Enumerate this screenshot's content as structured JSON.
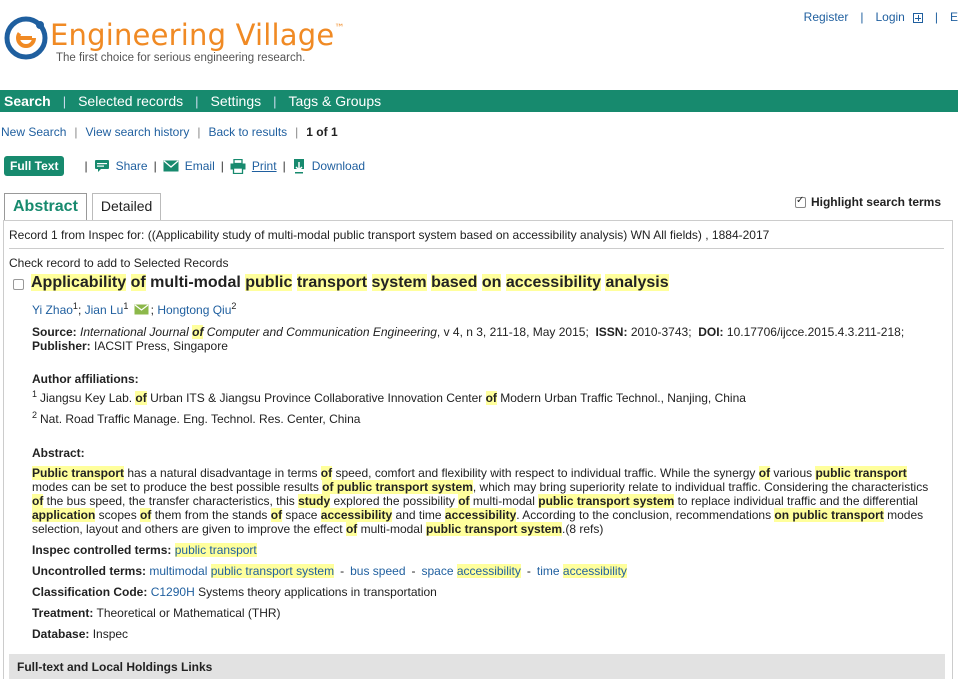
{
  "header": {
    "logo_text": "Engineering Village",
    "logo_tm": "™",
    "tagline": "The first choice for serious engineering research.",
    "register": "Register",
    "login": "Login",
    "extra": "E",
    "brand_orange": "#f08a24",
    "brand_blue": "#1f5f9f"
  },
  "nav": {
    "items": [
      "Search",
      "Selected records",
      "Settings",
      "Tags & Groups"
    ],
    "bg_color": "#178a6e"
  },
  "subnav": {
    "new_search": "New Search",
    "view_history": "View search history",
    "back": "Back to results",
    "count": "1 of 1"
  },
  "toolbar": {
    "full_text": "Full Text",
    "share": "Share",
    "email": "Email",
    "print": "Print",
    "download": "Download"
  },
  "tabs": {
    "abstract": "Abstract",
    "detailed": "Detailed",
    "highlight_label": "Highlight search terms",
    "highlight_checked": true
  },
  "record": {
    "info": "Record 1 from Inspec for: ((Applicability study of multi-modal public transport system based on accessibility analysis) WN All fields) , 1884-2017",
    "check_label": "Check record to add to Selected Records",
    "title_parts": [
      {
        "t": "Applicability",
        "h": true
      },
      {
        "t": " ",
        "h": false
      },
      {
        "t": "of",
        "h": true
      },
      {
        "t": " multi-modal ",
        "h": false
      },
      {
        "t": "public",
        "h": true
      },
      {
        "t": " ",
        "h": false
      },
      {
        "t": "transport",
        "h": true
      },
      {
        "t": " ",
        "h": false
      },
      {
        "t": "system",
        "h": true
      },
      {
        "t": " ",
        "h": false
      },
      {
        "t": "based",
        "h": true
      },
      {
        "t": " ",
        "h": false
      },
      {
        "t": "on",
        "h": true
      },
      {
        "t": " ",
        "h": false
      },
      {
        "t": "accessibility",
        "h": true
      },
      {
        "t": " ",
        "h": false
      },
      {
        "t": "analysis",
        "h": true
      }
    ],
    "authors": [
      {
        "name": "Yi Zhao",
        "sup": "1"
      },
      {
        "name": "Jian Lu",
        "sup": "1"
      },
      {
        "name": "Hongtong Qiu",
        "sup": "2"
      }
    ],
    "source_label": "Source:",
    "source_journal_pre": "International Journal ",
    "source_journal_of": "of",
    "source_journal_post": " Computer and Communication Engineering",
    "source_details": ", v 4, n 3, 211-18, May 2015;",
    "issn_label": "ISSN:",
    "issn": "2010-3743;",
    "doi_label": "DOI:",
    "doi": "10.17706/ijcce.2015.4.3.211-218;",
    "publisher_label": "Publisher:",
    "publisher": "IACSIT Press, Singapore",
    "aff_label": "Author affiliations:",
    "aff1_sup": "1",
    "aff1_pre": "Jiangsu Key Lab. ",
    "aff1_mid": " Urban ITS & Jiangsu Province Collaborative Innovation Center ",
    "aff1_post": " Modern Urban Traffic Technol., Nanjing, China",
    "of": "of",
    "aff2_sup": "2",
    "aff2": "Nat. Road Traffic Manage. Eng. Technol. Res. Center, China",
    "abstract_label": "Abstract:",
    "abstract_parts": [
      {
        "t": "Public transport",
        "h": true
      },
      {
        "t": " has a natural disadvantage in terms ",
        "h": false
      },
      {
        "t": "of",
        "h": true
      },
      {
        "t": " speed, comfort and flexibility with respect to individual traffic. While the synergy ",
        "h": false
      },
      {
        "t": "of",
        "h": true
      },
      {
        "t": " various ",
        "h": false
      },
      {
        "t": "public transport",
        "h": true
      },
      {
        "t": " modes can be set to produce the best possible results ",
        "h": false
      },
      {
        "t": "of public transport system",
        "h": true
      },
      {
        "t": ", which may bring superiority relate to individual traffic. Considering the characteristics ",
        "h": false
      },
      {
        "t": "of",
        "h": true
      },
      {
        "t": " the bus speed, the transfer characteristics, this ",
        "h": false
      },
      {
        "t": "study",
        "h": true
      },
      {
        "t": " explored the possibility ",
        "h": false
      },
      {
        "t": "of",
        "h": true
      },
      {
        "t": " multi-modal ",
        "h": false
      },
      {
        "t": "public transport system",
        "h": true
      },
      {
        "t": " to replace individual traffic and the differential ",
        "h": false
      },
      {
        "t": "application",
        "h": true
      },
      {
        "t": " scopes ",
        "h": false
      },
      {
        "t": "of",
        "h": true
      },
      {
        "t": " them from the stands ",
        "h": false
      },
      {
        "t": "of",
        "h": true
      },
      {
        "t": " space ",
        "h": false
      },
      {
        "t": "accessibility",
        "h": true
      },
      {
        "t": " and time ",
        "h": false
      },
      {
        "t": "accessibility",
        "h": true
      },
      {
        "t": ". According to the conclusion, recommendations ",
        "h": false
      },
      {
        "t": "on public transport",
        "h": true
      },
      {
        "t": " modes selection, layout and others are given to improve the effect ",
        "h": false
      },
      {
        "t": "of",
        "h": true
      },
      {
        "t": " multi-modal ",
        "h": false
      },
      {
        "t": "public transport system",
        "h": true
      },
      {
        "t": ".(8 refs)",
        "h": false
      }
    ],
    "inspec_label": "Inspec controlled terms:",
    "inspec_term": "public transport",
    "uncontrolled_label": "Uncontrolled terms:",
    "uncontrolled": [
      {
        "pre": "multimodal ",
        "hl": "public transport system"
      },
      {
        "pre": "bus speed",
        "hl": ""
      },
      {
        "pre": "space ",
        "hl": "accessibility"
      },
      {
        "pre": "time ",
        "hl": "accessibility"
      }
    ],
    "uncontrolled_sep": "-",
    "class_label": "Classification Code:",
    "class_code": "C1290H",
    "class_desc": " Systems theory applications in transportation",
    "treatment_label": "Treatment:",
    "treatment": "Theoretical or Mathematical (THR)",
    "database_label": "Database:",
    "database": "Inspec",
    "holdings": "Full-text and Local Holdings Links",
    "highlight_color": "#ffff9c"
  }
}
